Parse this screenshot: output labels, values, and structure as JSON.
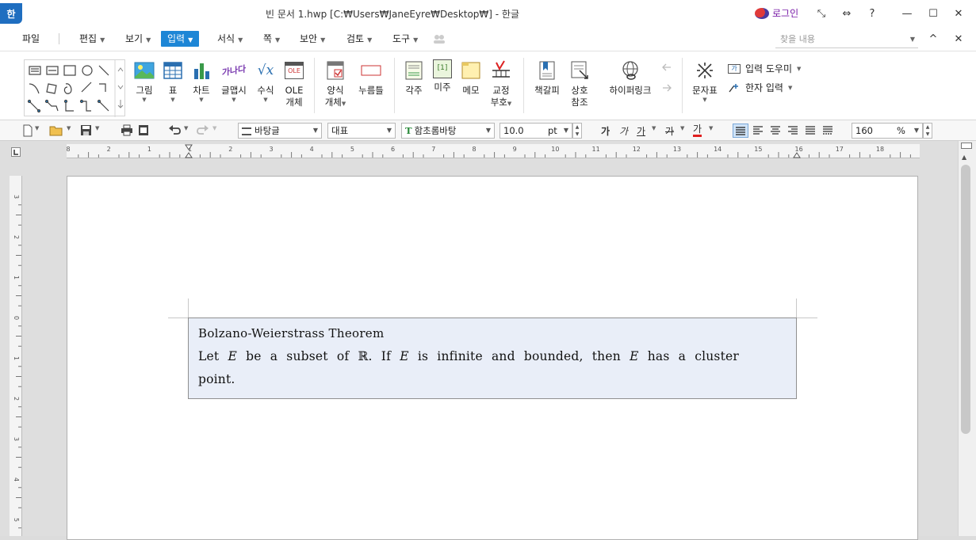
{
  "window": {
    "app_icon_label": "한",
    "title": "빈 문서 1.hwp [C:₩Users₩JaneEyre₩Desktop₩] - 한글",
    "login_label": "로그인",
    "controls": [
      "⤡",
      "⇔",
      "?",
      "—",
      "☐",
      "✕"
    ]
  },
  "menu": {
    "items": [
      {
        "label": "파일"
      },
      {
        "label": "편집"
      },
      {
        "label": "보기"
      },
      {
        "label": "입력"
      },
      {
        "label": "서식"
      },
      {
        "label": "쪽"
      },
      {
        "label": "보안"
      },
      {
        "label": "검토"
      },
      {
        "label": "도구"
      }
    ],
    "active": "입력",
    "search_placeholder": "찾을 내용",
    "right_controls": [
      "^",
      "✕"
    ]
  },
  "ribbon": {
    "buttons": {
      "picture": "그림",
      "table": "표",
      "chart": "차트",
      "textart": "글맵시",
      "equation": "수식",
      "ole_line1": "OLE",
      "ole_line2": "개체",
      "form_line1": "양식",
      "form_line2": "개체",
      "button_obj": "누름틀",
      "footnote": "각주",
      "endnote": "미주",
      "memo": "메모",
      "proof_line1": "교정",
      "proof_line2": "부호",
      "bookmark": "책갈피",
      "crossref_line1": "상호",
      "crossref_line2": "참조",
      "hyperlink": "하이퍼링크",
      "charmap": "문자표",
      "input_helper": "입력 도우미",
      "hanja_input": "한자 입력"
    },
    "icon_text": {
      "textart": "가나다",
      "equation": "√x",
      "ole": "OLE",
      "endnote": "[1]",
      "input_helper": "가"
    }
  },
  "format": {
    "style": "바탕글",
    "lang": "대표",
    "font": "함초롬바탕",
    "font_icon": "T",
    "size": "10.0",
    "size_unit": "pt",
    "bold": "가",
    "italic": "가",
    "underline": "가",
    "strike": "가",
    "color": "가",
    "zoom": "160",
    "zoom_unit": "%"
  },
  "ruler": {
    "h_ticks": [
      "8",
      "2",
      "1",
      "1",
      "2",
      "3",
      "4",
      "5",
      "6",
      "7",
      "8",
      "9",
      "10",
      "11",
      "12",
      "13",
      "14",
      "15",
      "16",
      "17",
      "18"
    ],
    "v_ticks": [
      "3",
      "2",
      "1",
      "0",
      "1",
      "2",
      "3",
      "4",
      "5"
    ]
  },
  "document": {
    "theorem_title": "Bolzano-Weierstrass Theorem",
    "body_line1_parts": [
      "Let",
      "E",
      "be a subset of",
      "ℝ",
      ". If",
      "E",
      "is infinite and bounded, then",
      "E",
      "has a cluster"
    ],
    "body_line2": "point."
  },
  "colors": {
    "accent": "#1d86d6",
    "theorem_bg": "#e9eef8",
    "login": "#7a1ea8"
  }
}
